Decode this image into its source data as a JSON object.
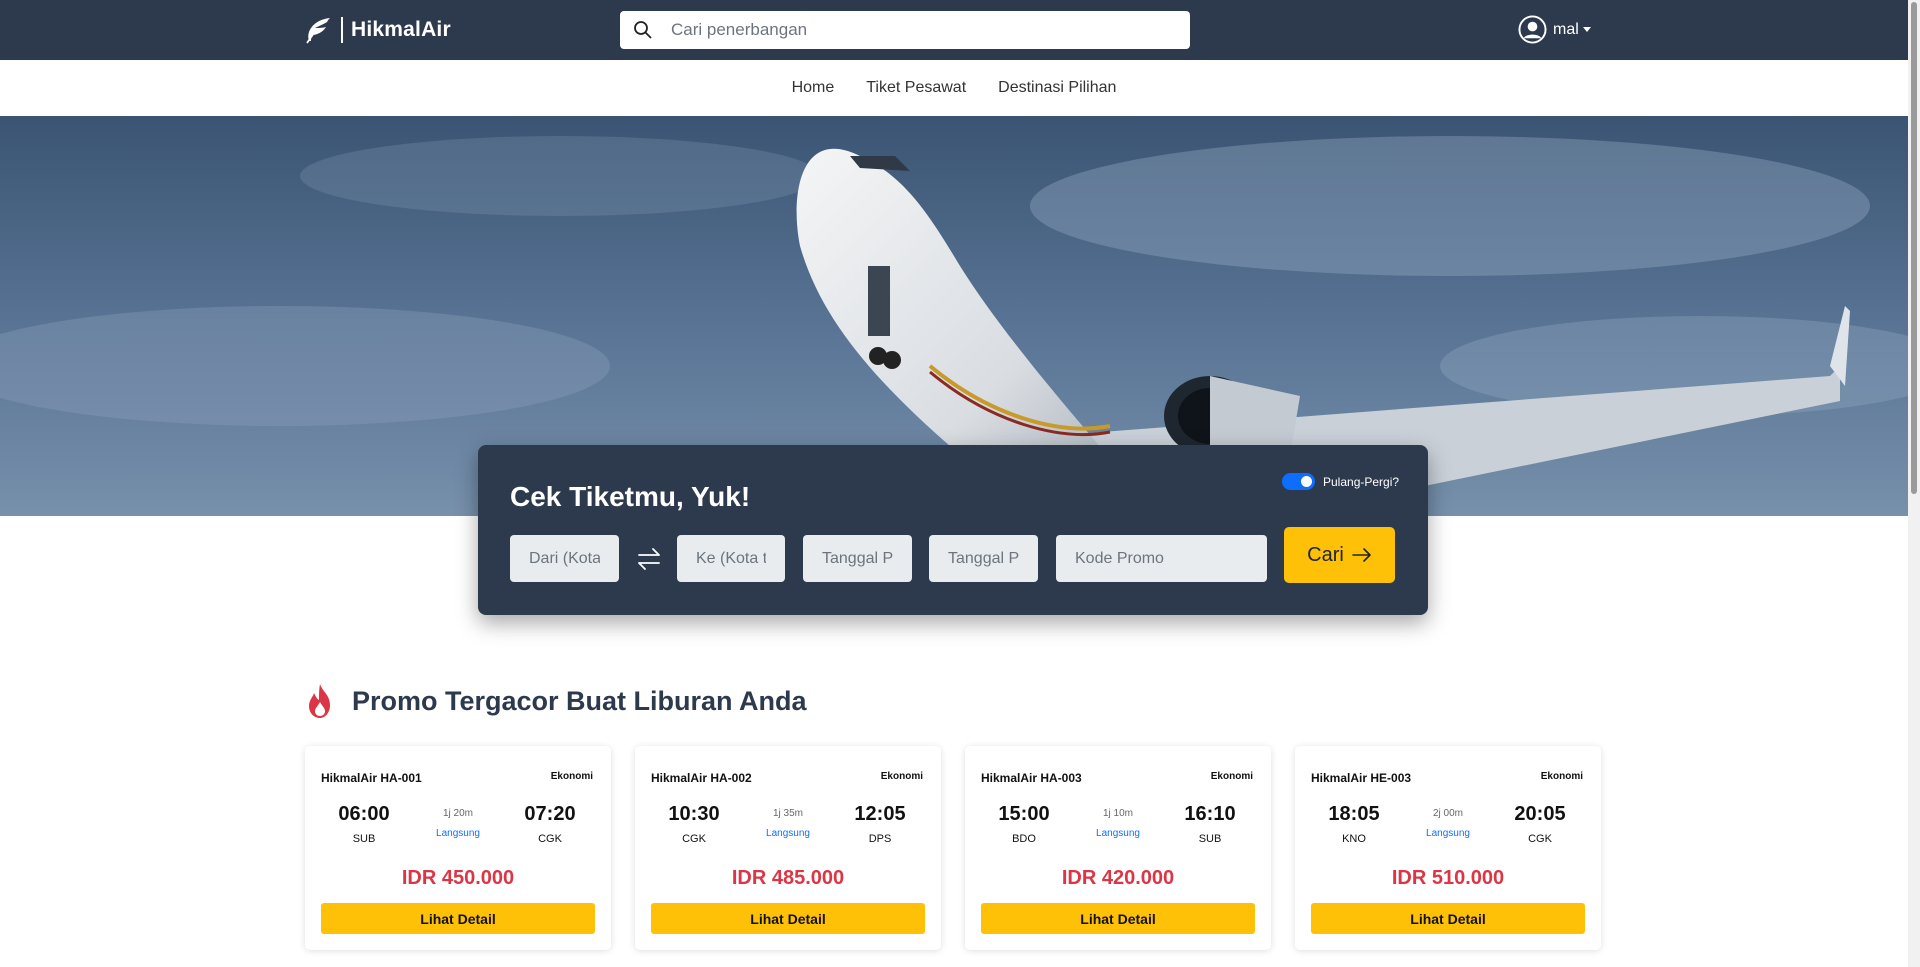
{
  "brand": {
    "name": "HikmalAir"
  },
  "search": {
    "placeholder": "Cari penerbangan"
  },
  "user": {
    "name": "mal"
  },
  "nav": {
    "items": [
      "Home",
      "Tiket Pesawat",
      "Destinasi Pilihan"
    ]
  },
  "booking": {
    "title": "Cek Tiketmu, Yuk!",
    "roundtrip_label": "Pulang-Pergi?",
    "roundtrip_on": true,
    "from_placeholder": "Dari (Kota asal)",
    "to_placeholder": "Ke (Kota tujuan)",
    "depart_placeholder": "Tanggal Pergi",
    "return_placeholder": "Tanggal Pulang",
    "promo_placeholder": "Kode Promo",
    "submit_label": "Cari"
  },
  "promo": {
    "heading": "Promo Tergacor Buat Liburan Anda",
    "flights": [
      {
        "name": "HikmalAir HA-001",
        "class": "Ekonomi",
        "dep_time": "06:00",
        "dep_code": "SUB",
        "duration": "1j 20m",
        "type": "Langsung",
        "arr_time": "07:20",
        "arr_code": "CGK",
        "price": "IDR 450.000",
        "button": "Lihat Detail"
      },
      {
        "name": "HikmalAir HA-002",
        "class": "Ekonomi",
        "dep_time": "10:30",
        "dep_code": "CGK",
        "duration": "1j 35m",
        "type": "Langsung",
        "arr_time": "12:05",
        "arr_code": "DPS",
        "price": "IDR 485.000",
        "button": "Lihat Detail"
      },
      {
        "name": "HikmalAir HA-003",
        "class": "Ekonomi",
        "dep_time": "15:00",
        "dep_code": "BDO",
        "duration": "1j 10m",
        "type": "Langsung",
        "arr_time": "16:10",
        "arr_code": "SUB",
        "price": "IDR 420.000",
        "button": "Lihat Detail"
      },
      {
        "name": "HikmalAir HE-003",
        "class": "Ekonomi",
        "dep_time": "18:05",
        "dep_code": "KNO",
        "duration": "2j 00m",
        "type": "Langsung",
        "arr_time": "20:05",
        "arr_code": "CGK",
        "price": "IDR 510.000",
        "button": "Lihat Detail"
      }
    ]
  },
  "colors": {
    "navbar": "#2d3a4d",
    "accent": "#ffc107",
    "price": "#dc3545",
    "link": "#0d6efd"
  },
  "icons": [
    "feather-logo-icon",
    "search-icon",
    "user-circle-icon",
    "swap-arrows-icon",
    "arrow-right-icon",
    "fire-icon"
  ]
}
